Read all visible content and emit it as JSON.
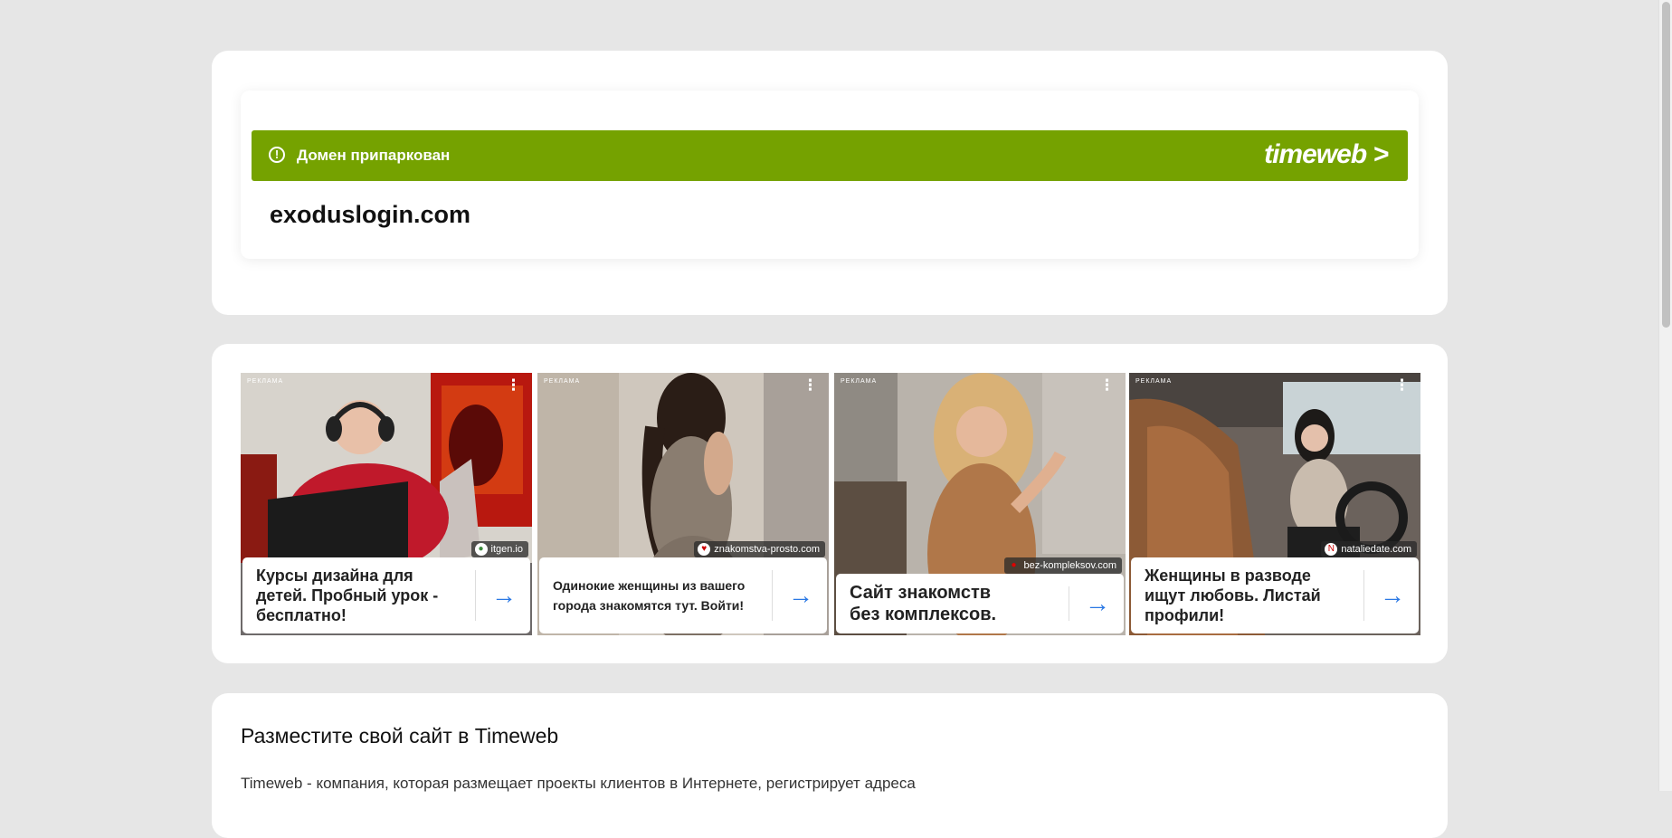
{
  "parked": {
    "status": "Домен припаркован",
    "brand": "timeweb >",
    "warning_icon": "!",
    "domain": "exoduslogin.com"
  },
  "ads": [
    {
      "label": "РЕКЛАМА",
      "source": "itgen.io",
      "title": "Курсы дизайна для детей. Пробный урок - бесплатно!",
      "image": "child-with-laptop-photo"
    },
    {
      "label": "РЕКЛАМА",
      "source": "znakomstva-prosto.com",
      "title": "Одинокие женщины из вашего города знакомятся тут. Войти!",
      "image": "woman-photo"
    },
    {
      "label": "РЕКЛАМА",
      "source": "bez-kompleksov.com",
      "title": "Сайт знакомств без комплексов.",
      "image": "blonde-woman-photo"
    },
    {
      "label": "РЕКЛАМА",
      "source": "nataliedate.com",
      "title": "Женщины в разводе ищут любовь. Листай профили!",
      "image": "woman-in-car-photo"
    }
  ],
  "info": {
    "title": "Разместите свой сайт в Timeweb",
    "text": "Timeweb - компания, которая размещает проекты клиентов в Интернете, регистрирует адреса"
  },
  "colors": {
    "accent_green": "#75a200",
    "arrow_blue": "#2a78e4",
    "page_bg": "#e6e6e6"
  }
}
